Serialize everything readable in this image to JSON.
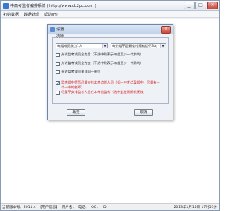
{
  "window": {
    "title": "中高考监考编排系统 ( http://www.dc2pc.com )",
    "minimize": "_",
    "maximize": "□",
    "close": "×"
  },
  "menu": [
    "初始数据",
    "数据处理",
    "帮助(H)"
  ],
  "dialog": {
    "title": "设置",
    "close": "×",
    "group_label": "选项",
    "select_left": "每组成员数为1人",
    "select_right": "每分组不是最佳时随机运行3次",
    "options": [
      {
        "checked": false,
        "text": "允许监考成员全为男（不选中则表示每组至少一个女的）",
        "red": false
      },
      {
        "checked": false,
        "text": "允许监考成员全为女（不选中则表示每组至少一个男的）",
        "red": false
      },
      {
        "checked": false,
        "text": "允许监考成员来自同一单位",
        "red": false
      },
      {
        "checked": true,
        "text": "监考组中是否尽量安排本考点的人员（如一中考点某组中，尽量有一个一中的老师）",
        "red": true
      },
      {
        "checked": false,
        "text": "尽量不安排监考人员在本单位监考（选中此处则随机无效）",
        "red": true
      }
    ],
    "ok": "确定",
    "cancel": "取消"
  },
  "statusbar": {
    "version": "当前版本号：2011.4",
    "user": "【用户信息】",
    "username": "用户名：",
    "phone": "电话：",
    "qq": "QQ：",
    "id": "ID：",
    "datetime": "2013年1月15日 17时53分"
  },
  "colors": {
    "red_text": "#d21e1e",
    "dialog_bg": "#eef1f6"
  }
}
